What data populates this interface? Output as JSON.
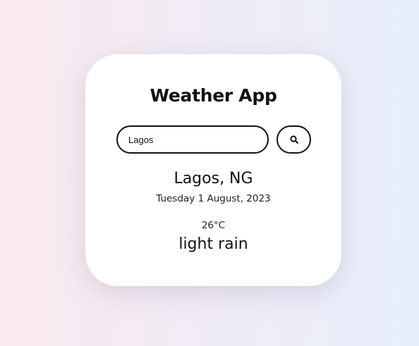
{
  "app": {
    "title": "Weather App"
  },
  "search": {
    "value": "Lagos",
    "placeholder": "",
    "button_icon": "search-icon"
  },
  "weather": {
    "location": "Lagos, NG",
    "date": "Tuesday 1 August, 2023",
    "temperature": "26°C",
    "condition": "light rain"
  },
  "colors": {
    "card_background": "#ffffff",
    "text": "#111111",
    "background_left": "#fbe9ef",
    "background_right": "#e8effc"
  }
}
